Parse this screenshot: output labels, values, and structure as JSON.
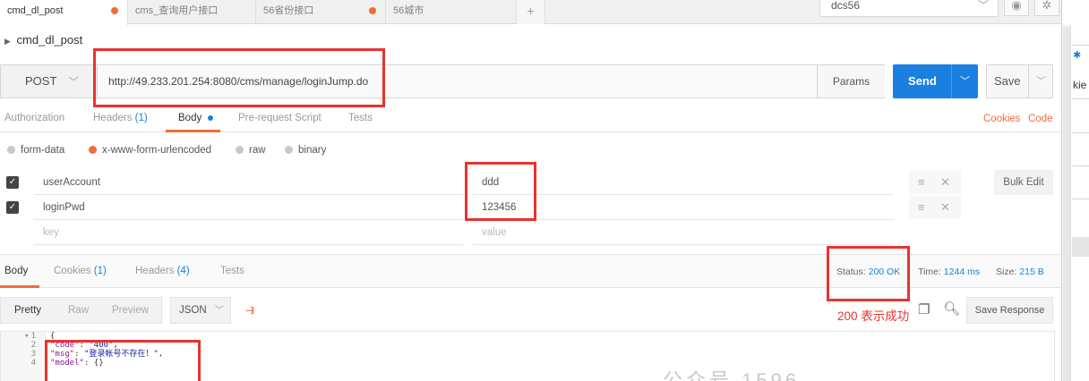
{
  "tabs": [
    {
      "label": "cmd_dl_post",
      "active": true,
      "modified": true
    },
    {
      "label": "cms_查询用户接口",
      "active": false,
      "modified": false
    },
    {
      "label": "56省份接口",
      "active": false,
      "modified": true
    },
    {
      "label": "56城市",
      "active": false,
      "modified": false
    }
  ],
  "new_tab_symbol": "+",
  "environment": {
    "selected": "dcs56"
  },
  "request": {
    "name": "cmd_dl_post",
    "method": "POST",
    "url": "http://49.233.201.254:8080/cms/manage/loginJump.do",
    "params_label": "Params",
    "send_label": "Send",
    "save_label": "Save"
  },
  "request_tabs": {
    "authorization": "Authorization",
    "headers": "Headers",
    "headers_count": "(1)",
    "body": "Body",
    "pre_request": "Pre-request Script",
    "tests": "Tests",
    "cookies": "Cookies",
    "code": "Code"
  },
  "body_types": [
    "form-data",
    "x-www-form-urlencoded",
    "raw",
    "binary"
  ],
  "body_type_selected": "x-www-form-urlencoded",
  "form_rows": [
    {
      "key": "userAccount",
      "value": "ddd",
      "checked": true
    },
    {
      "key": "loginPwd",
      "value": "123456",
      "checked": true
    }
  ],
  "placeholder": {
    "key": "key",
    "value": "value"
  },
  "row_icon_menu": "≡",
  "row_icon_delete": "✕",
  "bulk_edit_label": "Bulk Edit",
  "response_tabs": {
    "body": "Body",
    "cookies": "Cookies",
    "cookies_count": "(1)",
    "headers": "Headers",
    "headers_count": "(4)",
    "tests": "Tests"
  },
  "response_meta": {
    "status_label": "Status:",
    "status_value": "200 OK",
    "time_label": "Time:",
    "time_value": "1244 ms",
    "size_label": "Size:",
    "size_value": "215 B"
  },
  "view_modes": [
    "Pretty",
    "Raw",
    "Preview"
  ],
  "format": "JSON",
  "save_response_label": "Save Response",
  "annotation": "200 表示成功",
  "code_lines": [
    {
      "num": "1",
      "fold": "▾",
      "text": "{"
    },
    {
      "num": "2",
      "key": "\"code\"",
      "sep": ": ",
      "value": "\"400\"",
      "end": ","
    },
    {
      "num": "3",
      "key": "\"msg\"",
      "sep": ": ",
      "value": "\"登录帐号不存在！\"",
      "end": ","
    },
    {
      "num": "4",
      "key": "\"model\"",
      "sep": ": ",
      "value": "{}",
      "end": ""
    }
  ],
  "right_panel": {
    "text": "kie"
  },
  "colors": {
    "accent": "#f26b3a",
    "primary": "#1b7fe0",
    "annotation": "#e8332f"
  },
  "watermark": "公众号 1596..."
}
